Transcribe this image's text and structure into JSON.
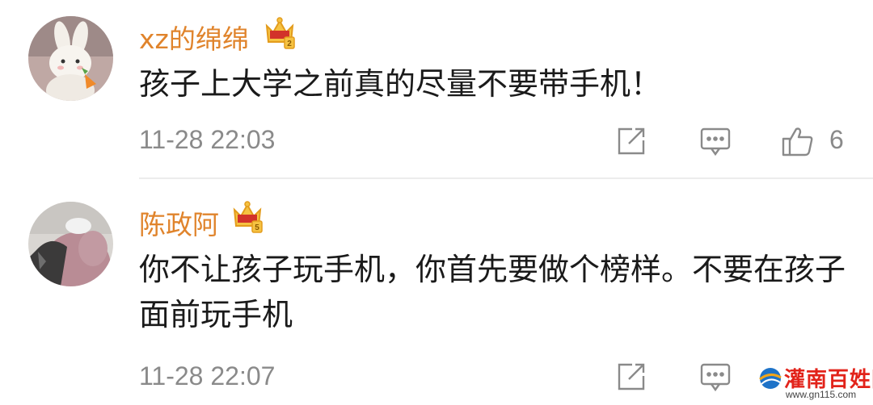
{
  "comments": [
    {
      "username": "xz的绵绵",
      "vip_level": "2",
      "text": "孩子上大学之前真的尽量不要带手机！",
      "time": "11-28 22:03",
      "like_count": "6",
      "avatar": "bunny-plush-avatar"
    },
    {
      "username": "陈政阿",
      "vip_level": "5",
      "text": "你不让孩子玩手机，你首先要做个榜样。不要在孩子面前玩手机",
      "time": "11-28 22:07",
      "like_count": "",
      "avatar": "pink-hoodie-avatar"
    }
  ],
  "actions": {
    "share_icon": "share-icon",
    "reply_icon": "comment-icon",
    "like_icon": "thumbs-up-icon"
  },
  "watermark": {
    "text": "灌南百姓网",
    "url": "www.gn115.com"
  },
  "colors": {
    "username": "#e0842c",
    "text": "#1a1a1a",
    "meta": "#8a8a8a",
    "divider": "#ececec",
    "watermark": "#e2231a"
  }
}
